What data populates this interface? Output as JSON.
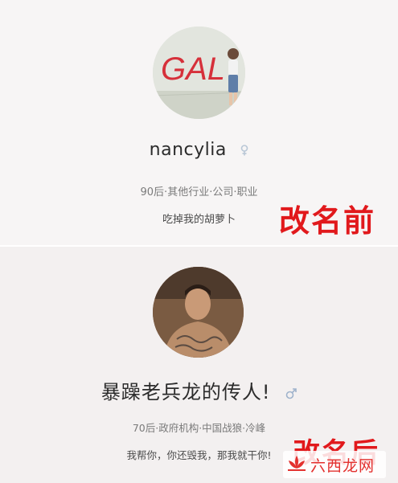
{
  "before": {
    "name": "nancylia",
    "gender_icon": "female-icon",
    "meta": "90后·其他行业·公司·职业",
    "signature": "吃掉我的胡萝卜",
    "caption": "改名前",
    "avatar_graffiti": "GAL"
  },
  "after": {
    "name": "暴躁老兵龙的传人!",
    "gender_icon": "male-icon",
    "meta": "70后·政府机构·中国战狼·冷峰",
    "signature": "我帮你，你还毁我，那我就干你!",
    "caption": "改名后"
  },
  "watermark": {
    "text": "六西龙网",
    "icon": "lotus-logo-icon"
  },
  "colors": {
    "caption": "#e1191c",
    "gender_icon": "#b9c7d6"
  }
}
